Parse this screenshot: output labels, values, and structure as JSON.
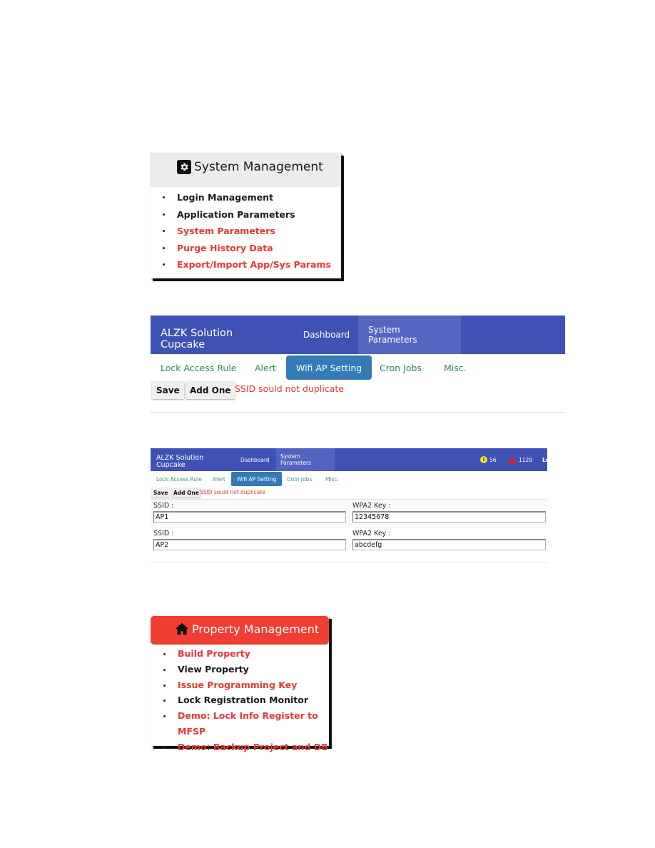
{
  "system_management": {
    "title": "System Management",
    "icon": "gear-icon",
    "items": [
      {
        "label": "Login Management",
        "color": "#1a1a1a"
      },
      {
        "label": "Application Parameters",
        "color": "#1a1a1a"
      },
      {
        "label": "System Parameters",
        "color": "#e53935"
      },
      {
        "label": "Purge History Data",
        "color": "#e53935"
      },
      {
        "label": "Export/Import App/Sys Params",
        "color": "#e53935"
      }
    ]
  },
  "app_large": {
    "brand_line1": "ALZK Solution",
    "brand_line2": "Cupcake",
    "nav": {
      "dashboard": "Dashboard",
      "system_parameters": "System Parameters"
    },
    "tabs": [
      "Lock Access Rule",
      "Alert",
      "Wifi AP Setting",
      "Cron Jobs",
      "Misc."
    ],
    "active_tab": "Wifi AP Setting",
    "buttons": {
      "save": "Save",
      "add_one": "Add One"
    },
    "error_message": "SSID sould not duplicate",
    "colors": {
      "topbar": "#3f51b5",
      "active_tab": "#337ab7",
      "tab_text": "#2e8b57",
      "error": "#e53935"
    }
  },
  "app_small": {
    "brand_line1": "ALZK Solution",
    "brand_line2": "Cupcake",
    "nav": {
      "dashboard": "Dashboard",
      "system_parameters": "System Parameters"
    },
    "status": {
      "info_count": "56",
      "warning_count": "1129",
      "user_link": "Lo"
    },
    "tabs": [
      "Lock Access Rule",
      "Alert",
      "Wifi AP Setting",
      "Cron Jobs",
      "Misc."
    ],
    "active_tab": "Wifi AP Setting",
    "buttons": {
      "save": "Save",
      "add_one": "Add One"
    },
    "error_message": "SSID sould not duplicate",
    "access_points": [
      {
        "ssid_label": "SSID :",
        "ssid": "AP1",
        "key_label": "WPA2 Key :",
        "key": "12345678"
      },
      {
        "ssid_label": "SSID :",
        "ssid": "AP2",
        "key_label": "WPA2 Key :",
        "key": "abcdefg"
      }
    ]
  },
  "property_management": {
    "title": "Property Management",
    "icon": "home-icon",
    "header_color": "#f03e33",
    "items": [
      {
        "label": "Build Property",
        "color": "#e53935"
      },
      {
        "label": "View Property",
        "color": "#1a1a1a"
      },
      {
        "label": "Issue Programming Key",
        "color": "#e53935"
      },
      {
        "label": "Lock Registration Monitor",
        "color": "#1a1a1a"
      },
      {
        "label": "Demo: Lock Info Register to MFSP",
        "color": "#e53935"
      },
      {
        "label": "Demo: Backup Project and DB",
        "color": "#e53935"
      }
    ]
  }
}
